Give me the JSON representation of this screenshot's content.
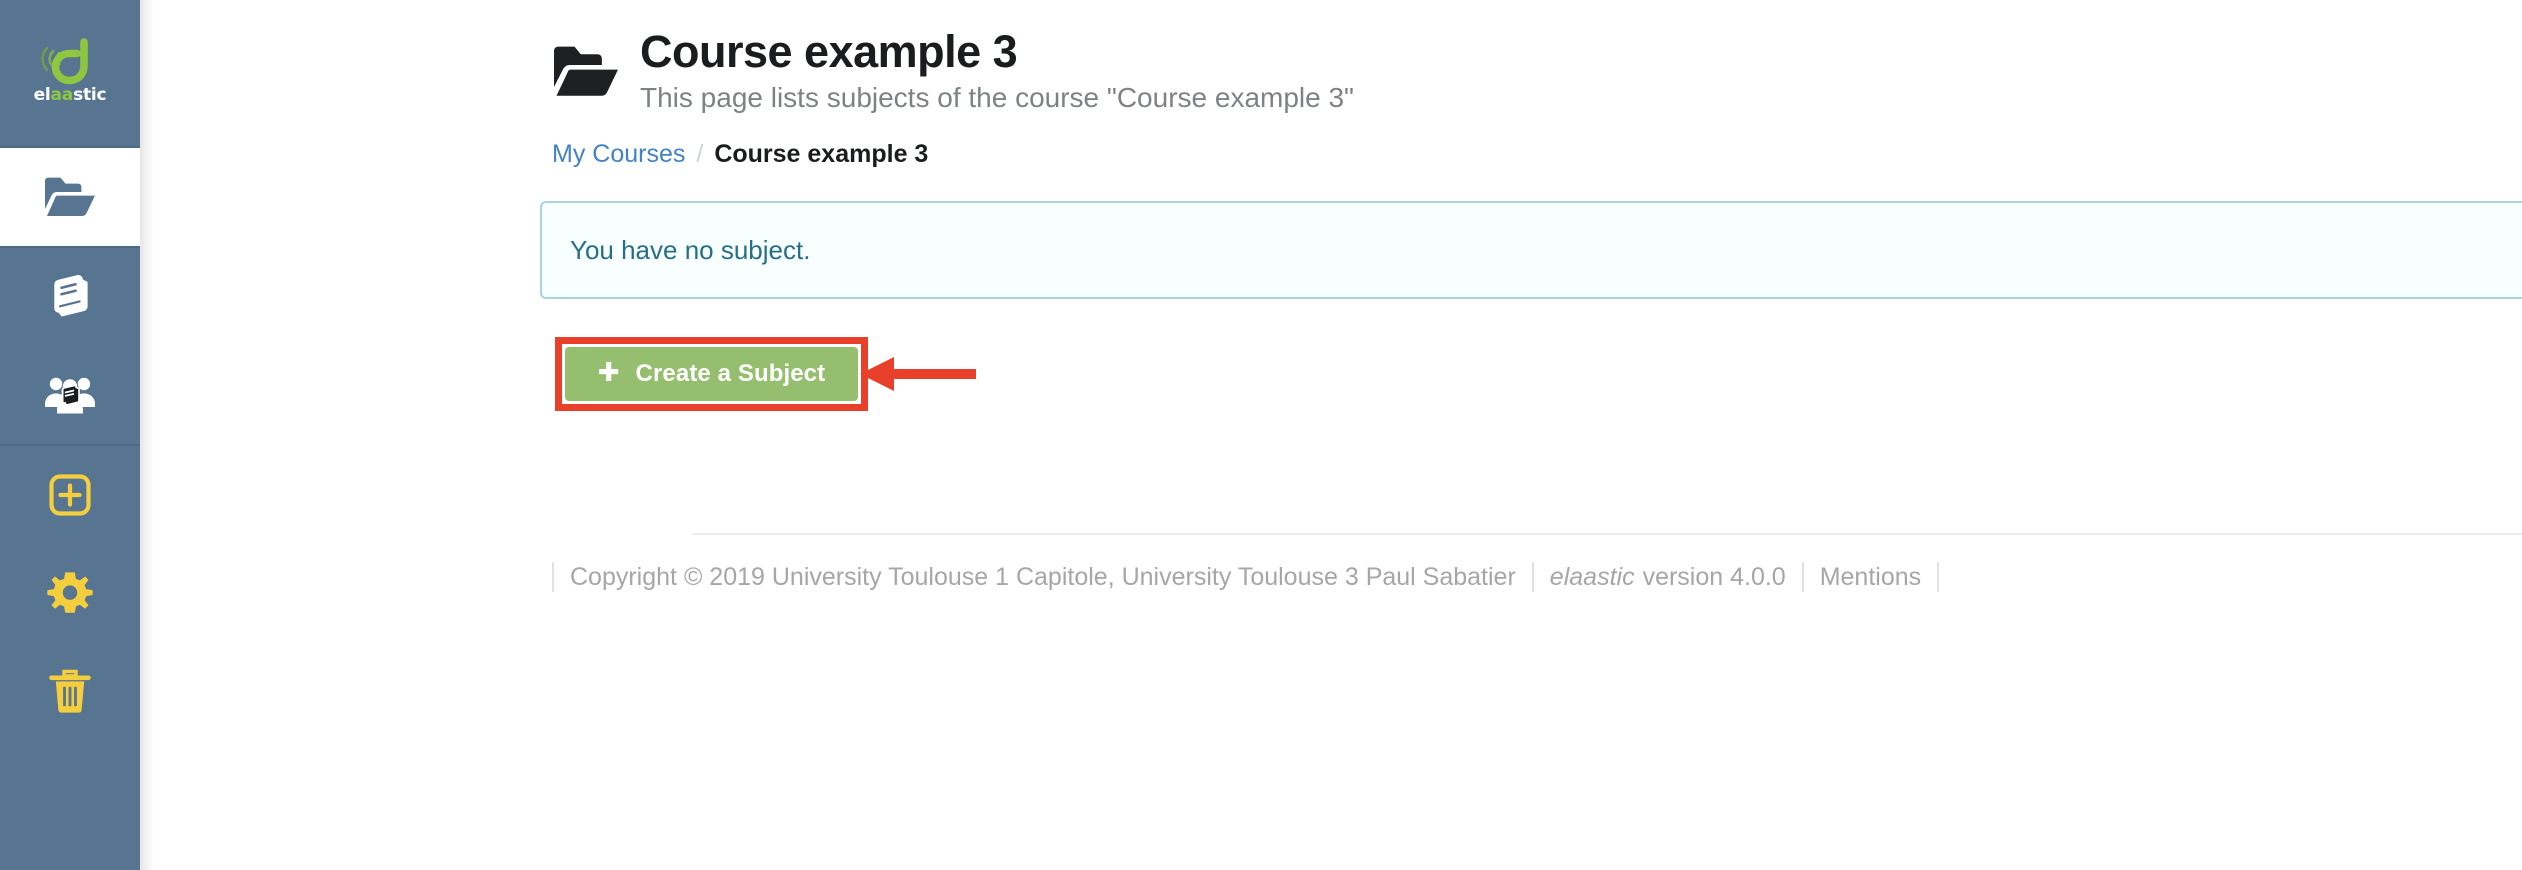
{
  "brand": {
    "logo_word_part1": "el",
    "logo_word_part2": "aa",
    "logo_word_part3": "stic",
    "accent_green": "#8dc63f",
    "sidebar_bg": "#577590",
    "accent_yellow": "#f5ce3e"
  },
  "sidebar": {
    "items": [
      {
        "name": "courses",
        "icon": "folder-open-icon",
        "active": true
      },
      {
        "name": "subjects",
        "icon": "book-icon",
        "active": false
      },
      {
        "name": "groups",
        "icon": "users-book-icon",
        "active": false
      },
      {
        "name": "create",
        "icon": "plus-square-icon",
        "active": false
      },
      {
        "name": "settings",
        "icon": "gear-icon",
        "active": false
      },
      {
        "name": "trash",
        "icon": "trash-icon",
        "active": false
      }
    ]
  },
  "header": {
    "icon": "folder-open-icon",
    "title": "Course example 3",
    "subtitle": "This page lists subjects of the course \"Course example 3\""
  },
  "breadcrumb": {
    "parent_label": "My Courses",
    "separator": "/",
    "current_label": "Course example 3"
  },
  "alert": {
    "type": "info",
    "message": "You have no subject.",
    "bg_color": "#f8ffff",
    "border_color": "#a9d5de",
    "text_color": "#276f86"
  },
  "actions": {
    "create_subject": {
      "label": "Create a Subject",
      "icon": "plus-icon",
      "color": "#95bf6e"
    },
    "annotation": {
      "highlight_color": "#e8402a",
      "arrow_direction": "left"
    }
  },
  "footer": {
    "copyright": "Copyright © 2019 University Toulouse 1 Capitole, University Toulouse 3 Paul Sabatier",
    "brand": "elaastic",
    "version": "version 4.0.0",
    "mentions": "Mentions"
  }
}
